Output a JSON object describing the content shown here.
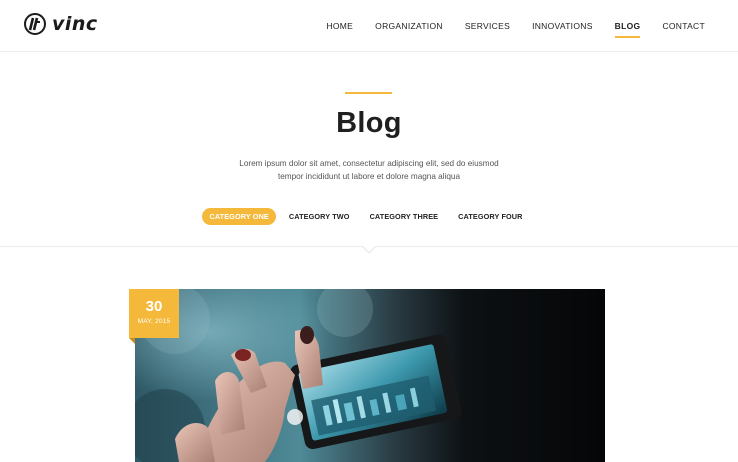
{
  "brand": {
    "name": "vinc"
  },
  "nav": {
    "items": [
      "HOME",
      "ORGANIZATION",
      "SERVICES",
      "INNOVATIONS",
      "BLOG",
      "CONTACT"
    ],
    "active": "BLOG"
  },
  "hero": {
    "title": "Blog",
    "description": "Lorem ipsum dolor sit amet, consectetur adipiscing elit, sed do eiusmod tempor incididunt ut labore et dolore magna aliqua"
  },
  "categories": {
    "items": [
      "CATEGORY ONE",
      "CATEGORY TWO",
      "CATEGORY THREE",
      "CATEGORY FOUR"
    ],
    "active": "CATEGORY ONE"
  },
  "post": {
    "date_day": "30",
    "date_month": "MAY, 2015"
  },
  "colors": {
    "accent": "#f4b93a",
    "text": "#222222",
    "muted": "#555555",
    "border": "#ececec"
  }
}
